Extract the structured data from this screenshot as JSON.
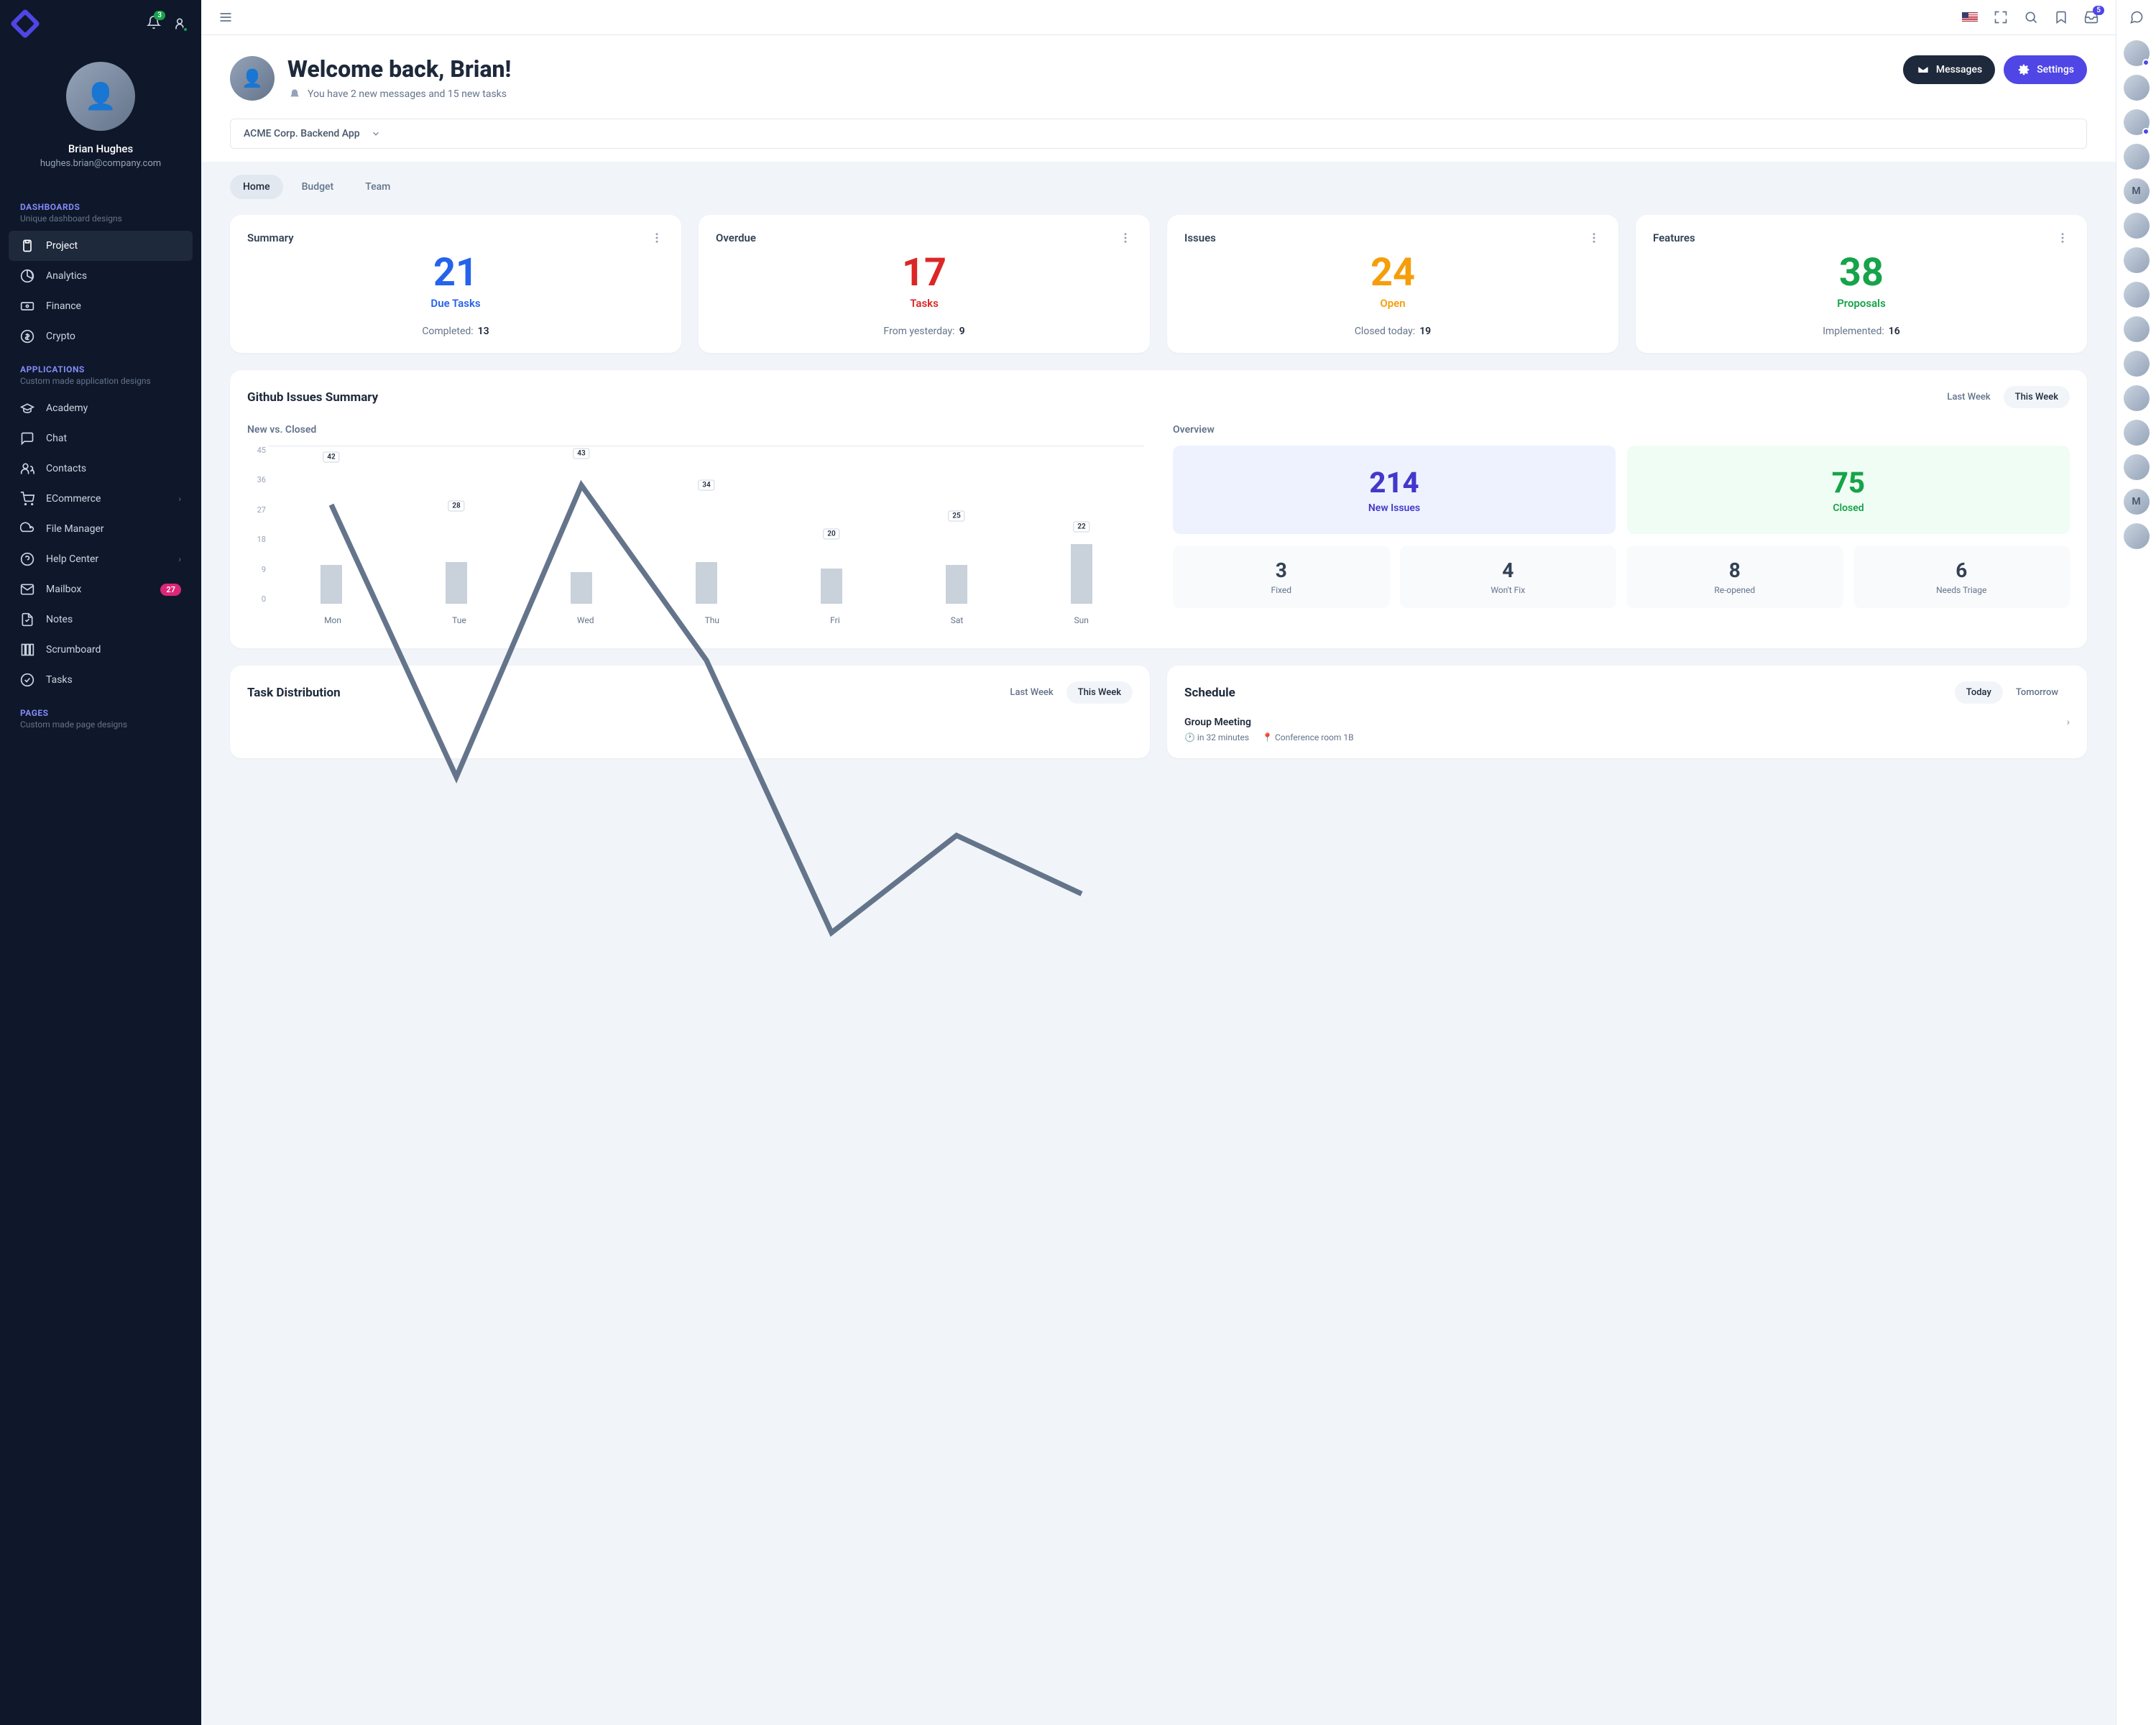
{
  "sidebar": {
    "notif_count": "3",
    "user_name": "Brian Hughes",
    "user_email": "hughes.brian@company.com",
    "sections": [
      {
        "heading": "Dashboards",
        "sub": "Unique dashboard designs",
        "items": [
          {
            "label": "Project",
            "icon": "clipboard",
            "active": true
          },
          {
            "label": "Analytics",
            "icon": "pie"
          },
          {
            "label": "Finance",
            "icon": "cash"
          },
          {
            "label": "Crypto",
            "icon": "dollar"
          }
        ]
      },
      {
        "heading": "Applications",
        "sub": "Custom made application designs",
        "items": [
          {
            "label": "Academy",
            "icon": "cap"
          },
          {
            "label": "Chat",
            "icon": "chat"
          },
          {
            "label": "Contacts",
            "icon": "users"
          },
          {
            "label": "ECommerce",
            "icon": "cart",
            "expand": true
          },
          {
            "label": "File Manager",
            "icon": "cloud"
          },
          {
            "label": "Help Center",
            "icon": "help",
            "expand": true
          },
          {
            "label": "Mailbox",
            "icon": "mail",
            "count": "27"
          },
          {
            "label": "Notes",
            "icon": "note"
          },
          {
            "label": "Scrumboard",
            "icon": "columns"
          },
          {
            "label": "Tasks",
            "icon": "check"
          }
        ]
      },
      {
        "heading": "Pages",
        "sub": "Custom made page designs",
        "items": []
      }
    ]
  },
  "topbar": {
    "inbox_count": "5"
  },
  "header": {
    "title": "Welcome back, Brian!",
    "subtitle": "You have 2 new messages and 15 new tasks",
    "messages_btn": "Messages",
    "settings_btn": "Settings"
  },
  "project_selector": "ACME Corp. Backend App",
  "tabs": [
    "Home",
    "Budget",
    "Team"
  ],
  "stat_cards": [
    {
      "title": "Summary",
      "value": "21",
      "label": "Due Tasks",
      "foot_k": "Completed:",
      "foot_v": "13",
      "color": "c-blue"
    },
    {
      "title": "Overdue",
      "value": "17",
      "label": "Tasks",
      "foot_k": "From yesterday:",
      "foot_v": "9",
      "color": "c-red"
    },
    {
      "title": "Issues",
      "value": "24",
      "label": "Open",
      "foot_k": "Closed today:",
      "foot_v": "19",
      "color": "c-amber"
    },
    {
      "title": "Features",
      "value": "38",
      "label": "Proposals",
      "foot_k": "Implemented:",
      "foot_v": "16",
      "color": "c-green"
    }
  ],
  "github": {
    "title": "Github Issues Summary",
    "range": [
      "Last Week",
      "This Week"
    ],
    "range_active": 1,
    "left_title": "New vs. Closed",
    "right_title": "Overview",
    "overview_big": [
      {
        "value": "214",
        "label": "New Issues",
        "cls": "indigo",
        "vc": "c-indigo"
      },
      {
        "value": "75",
        "label": "Closed",
        "cls": "green",
        "vc": "c-green"
      }
    ],
    "overview_small": [
      {
        "value": "3",
        "label": "Fixed"
      },
      {
        "value": "4",
        "label": "Won't Fix"
      },
      {
        "value": "8",
        "label": "Re-opened"
      },
      {
        "value": "6",
        "label": "Needs Triage"
      }
    ]
  },
  "chart_data": {
    "type": "bar+line",
    "categories": [
      "Mon",
      "Tue",
      "Wed",
      "Thu",
      "Fri",
      "Sat",
      "Sun"
    ],
    "y_ticks": [
      45,
      36,
      27,
      18,
      9,
      0
    ],
    "ylim": [
      0,
      45
    ],
    "series": [
      {
        "name": "line",
        "values": [
          42,
          28,
          43,
          34,
          20,
          25,
          22
        ]
      },
      {
        "name": "bar",
        "values": [
          11,
          12,
          9,
          12,
          10,
          11,
          17
        ]
      }
    ]
  },
  "task_dist": {
    "title": "Task Distribution",
    "range": [
      "Last Week",
      "This Week"
    ],
    "range_active": 1
  },
  "schedule": {
    "title": "Schedule",
    "range": [
      "Today",
      "Tomorrow"
    ],
    "range_active": 0,
    "items": [
      {
        "title": "Group Meeting",
        "time": "in 32 minutes",
        "loc": "Conference room 1B"
      }
    ]
  },
  "presence": [
    {
      "type": "av",
      "status": "on"
    },
    {
      "type": "av"
    },
    {
      "type": "av",
      "status": "on"
    },
    {
      "type": "av"
    },
    {
      "type": "letter",
      "letter": "M"
    },
    {
      "type": "av"
    },
    {
      "type": "av"
    },
    {
      "type": "av"
    },
    {
      "type": "av"
    },
    {
      "type": "av"
    },
    {
      "type": "av"
    },
    {
      "type": "av"
    },
    {
      "type": "av"
    },
    {
      "type": "letter",
      "letter": "M"
    },
    {
      "type": "av"
    }
  ]
}
